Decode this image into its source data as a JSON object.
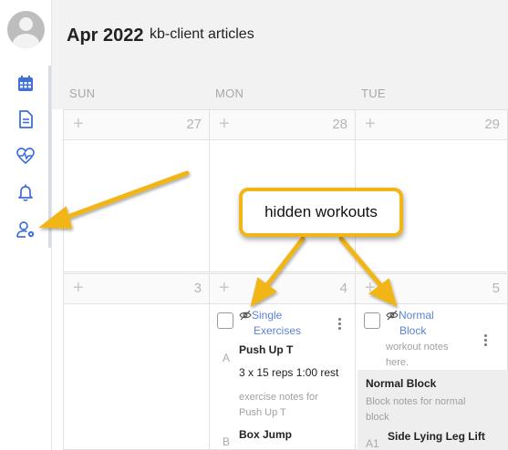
{
  "header": {
    "month_year": "Apr 2022",
    "client": "kb-client articles"
  },
  "sidebar": {
    "items": [
      {
        "icon": "calendar-icon"
      },
      {
        "icon": "document-icon"
      },
      {
        "icon": "heart-pulse-icon"
      },
      {
        "icon": "bell-icon"
      },
      {
        "icon": "user-settings-icon"
      }
    ]
  },
  "days": [
    "SUN",
    "MON",
    "TUE"
  ],
  "weeks": [
    {
      "dates": [
        "27",
        "28",
        "29"
      ]
    },
    {
      "dates": [
        "3",
        "4",
        "5"
      ]
    }
  ],
  "workouts": {
    "mon": {
      "title_line1": "Single",
      "title_line2": "Exercises",
      "exercises": [
        {
          "label": "A",
          "name": "Push Up T",
          "reps": "3 x 15 reps 1:00 rest",
          "notes_line1": "exercise notes for",
          "notes_line2": "Push Up T"
        },
        {
          "label": "B",
          "name": "Box Jump"
        }
      ]
    },
    "tue": {
      "title_line1": "Normal",
      "title_line2": "Block",
      "notes_line1": "workout notes",
      "notes_line2": "here.",
      "block": {
        "title": "Normal Block",
        "notes_line1": "Block notes for normal",
        "notes_line2": "block",
        "exercise_label": "A1",
        "exercise_name": "Side Lying Leg Lift"
      }
    }
  },
  "callout": {
    "text": "hidden workouts"
  },
  "colors": {
    "accent_blue": "#5b82d6",
    "callout_yellow": "#f2b518",
    "sidebar_icon": "#3f6fd8"
  }
}
